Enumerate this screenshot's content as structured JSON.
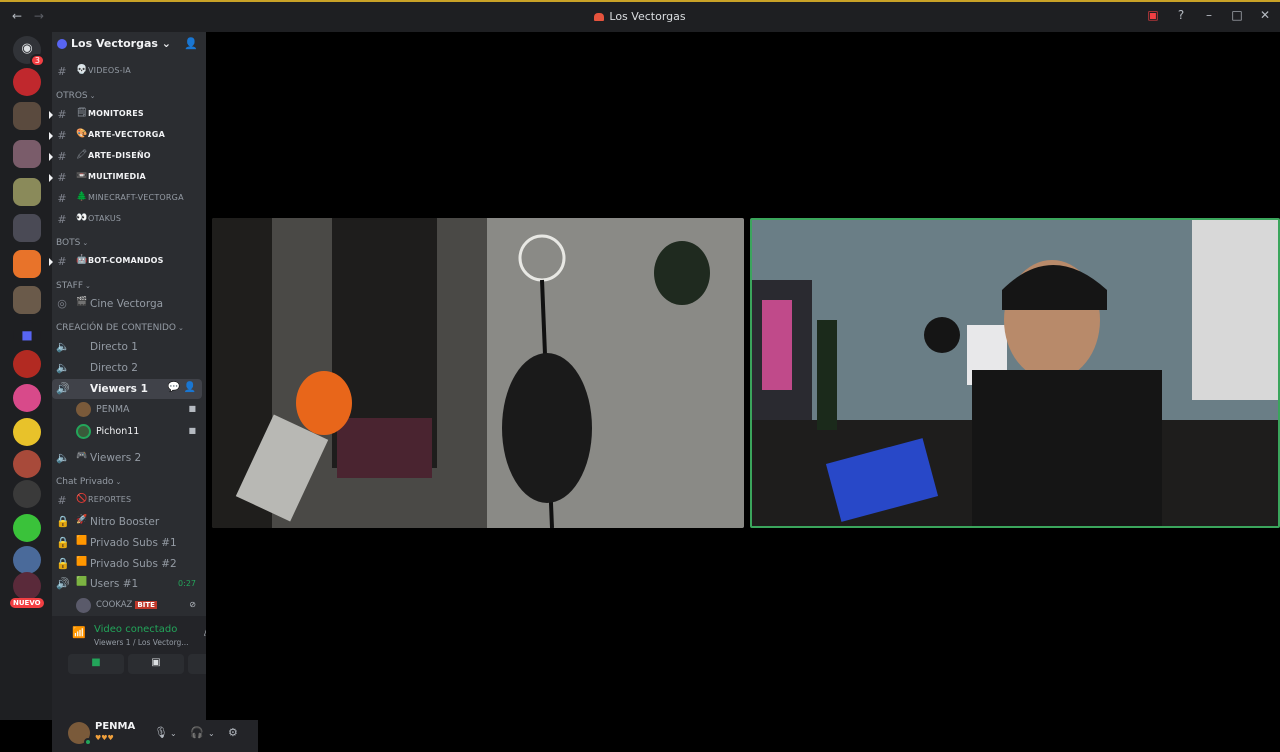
{
  "titlebar": {
    "title": "Los Vectorgas",
    "back": "←",
    "forward": "→",
    "inbox_icon": "inbox-icon",
    "help_icon": "help-icon",
    "minimize": "–",
    "maximize": "□",
    "close": "✕"
  },
  "guilds": {
    "home_badge": "3",
    "nuevo_label": "NUEVO"
  },
  "server": {
    "name": "Los Vectorgas",
    "chevron": "⌄"
  },
  "channels": {
    "top_channel": {
      "emoji": "💀",
      "name": "VIDEOS-IA"
    },
    "cat_otros": "OTROS",
    "otros": [
      {
        "emoji": "🗒",
        "name": "MONITORES"
      },
      {
        "emoji": "🎨",
        "name": "ARTE-VECTORGA"
      },
      {
        "emoji": "🖍",
        "name": "ARTE-DISEÑO"
      },
      {
        "emoji": "📼",
        "name": "MULTIMEDIA"
      },
      {
        "emoji": "🌲",
        "name": "MINECRAFT-VECTORGA"
      },
      {
        "emoji": "👀",
        "name": "OTAKUS"
      }
    ],
    "cat_bots": "BOTS",
    "bots": [
      {
        "emoji": "🤖",
        "name": "BOT-COMANDOS"
      }
    ],
    "cat_staff": "STAFF",
    "staff": [
      {
        "emoji": "🎬",
        "name": "Cine Vectorga"
      }
    ],
    "cat_creacion": "CREACIÓN DE CONTENIDO",
    "creacion": [
      {
        "name": "Directo 1"
      },
      {
        "name": "Directo 2"
      },
      {
        "name": "Viewers 1"
      },
      {
        "name": "Viewers 2"
      }
    ],
    "voice_users": [
      {
        "name": "PENMA"
      },
      {
        "name": "Pichon11"
      }
    ],
    "cat_privado": "Chat Privado",
    "privado": [
      {
        "emoji": "🚫",
        "name": "REPORTES"
      },
      {
        "emoji": "🚀",
        "name": "Nitro Booster"
      },
      {
        "emoji": "🟧",
        "name": "Privado Subs #1"
      },
      {
        "emoji": "🟧",
        "name": "Privado Subs #2"
      },
      {
        "emoji": "🟩",
        "name": "Users #1",
        "timer": "0:27"
      }
    ],
    "users1_member": {
      "name": "COOKAZ",
      "tag": "BITE"
    }
  },
  "voice_panel": {
    "status": "Video conectado",
    "location": "Viewers 1 / Los Vectorg..."
  },
  "user": {
    "name": "PENMA",
    "hearts": "♥♥♥"
  },
  "colors": {
    "green": "#23a55a",
    "blurple": "#5865f2",
    "red": "#f23f43"
  }
}
